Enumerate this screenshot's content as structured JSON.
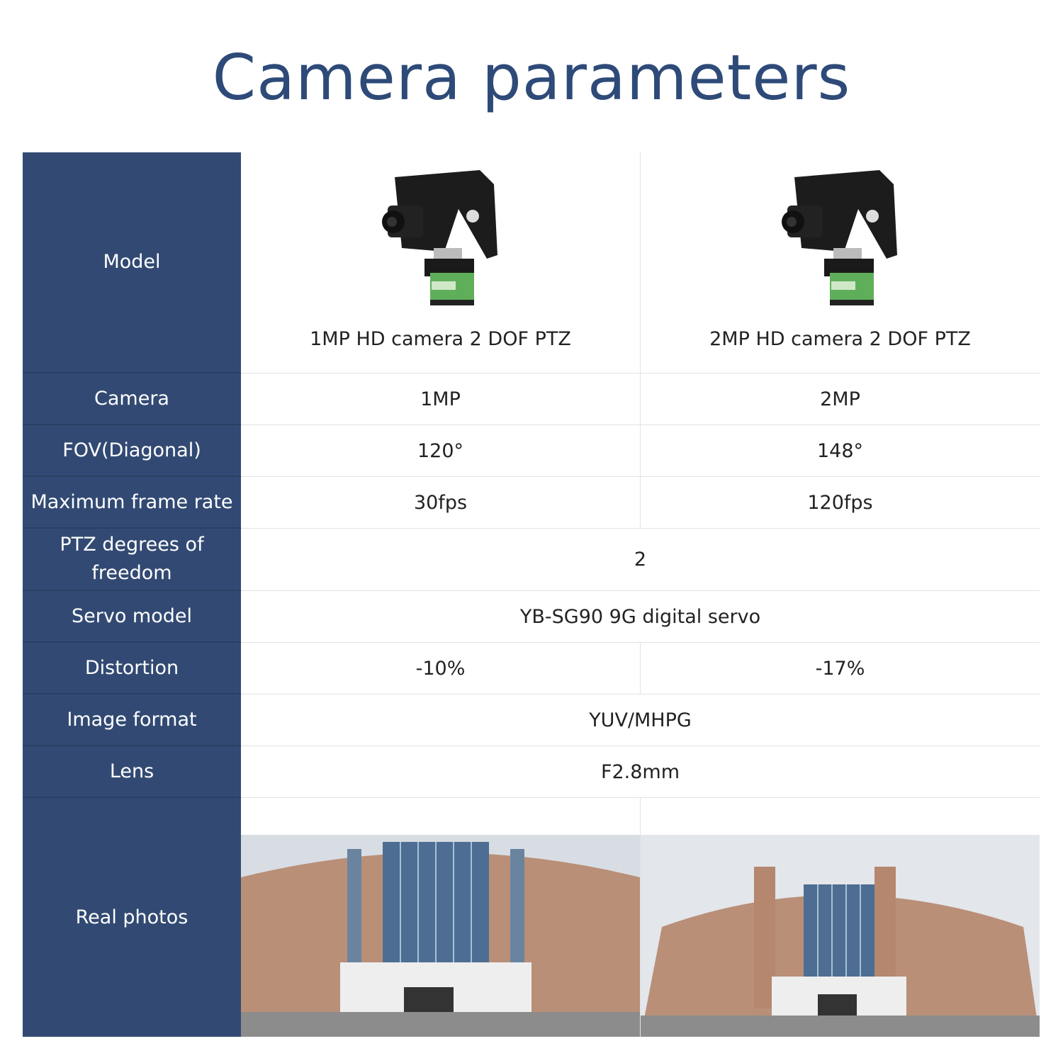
{
  "title": "Camera parameters",
  "colors": {
    "header_bg": "#324a73",
    "title": "#2e4a78"
  },
  "rows": [
    {
      "label": "Model",
      "values": [
        "1MP HD camera 2 DOF PTZ",
        "2MP HD camera 2 DOF PTZ"
      ]
    },
    {
      "label": "Camera",
      "values": [
        "1MP",
        "2MP"
      ]
    },
    {
      "label": "FOV(Diagonal)",
      "values": [
        "120°",
        "148°"
      ]
    },
    {
      "label": "Maximum frame rate",
      "values": [
        "30fps",
        "120fps"
      ]
    },
    {
      "label": "PTZ degrees of freedom",
      "value": "2"
    },
    {
      "label": "Servo model",
      "value": "YB-SG90 9G digital servo"
    },
    {
      "label": "Distortion",
      "values": [
        "-10%",
        "-17%"
      ]
    },
    {
      "label": "Image format",
      "value": "YUV/MHPG"
    },
    {
      "label": "Lens",
      "value": "F2.8mm"
    },
    {
      "label": "Real photos",
      "images": [
        "building-photo-1mp",
        "building-photo-2mp"
      ]
    }
  ]
}
